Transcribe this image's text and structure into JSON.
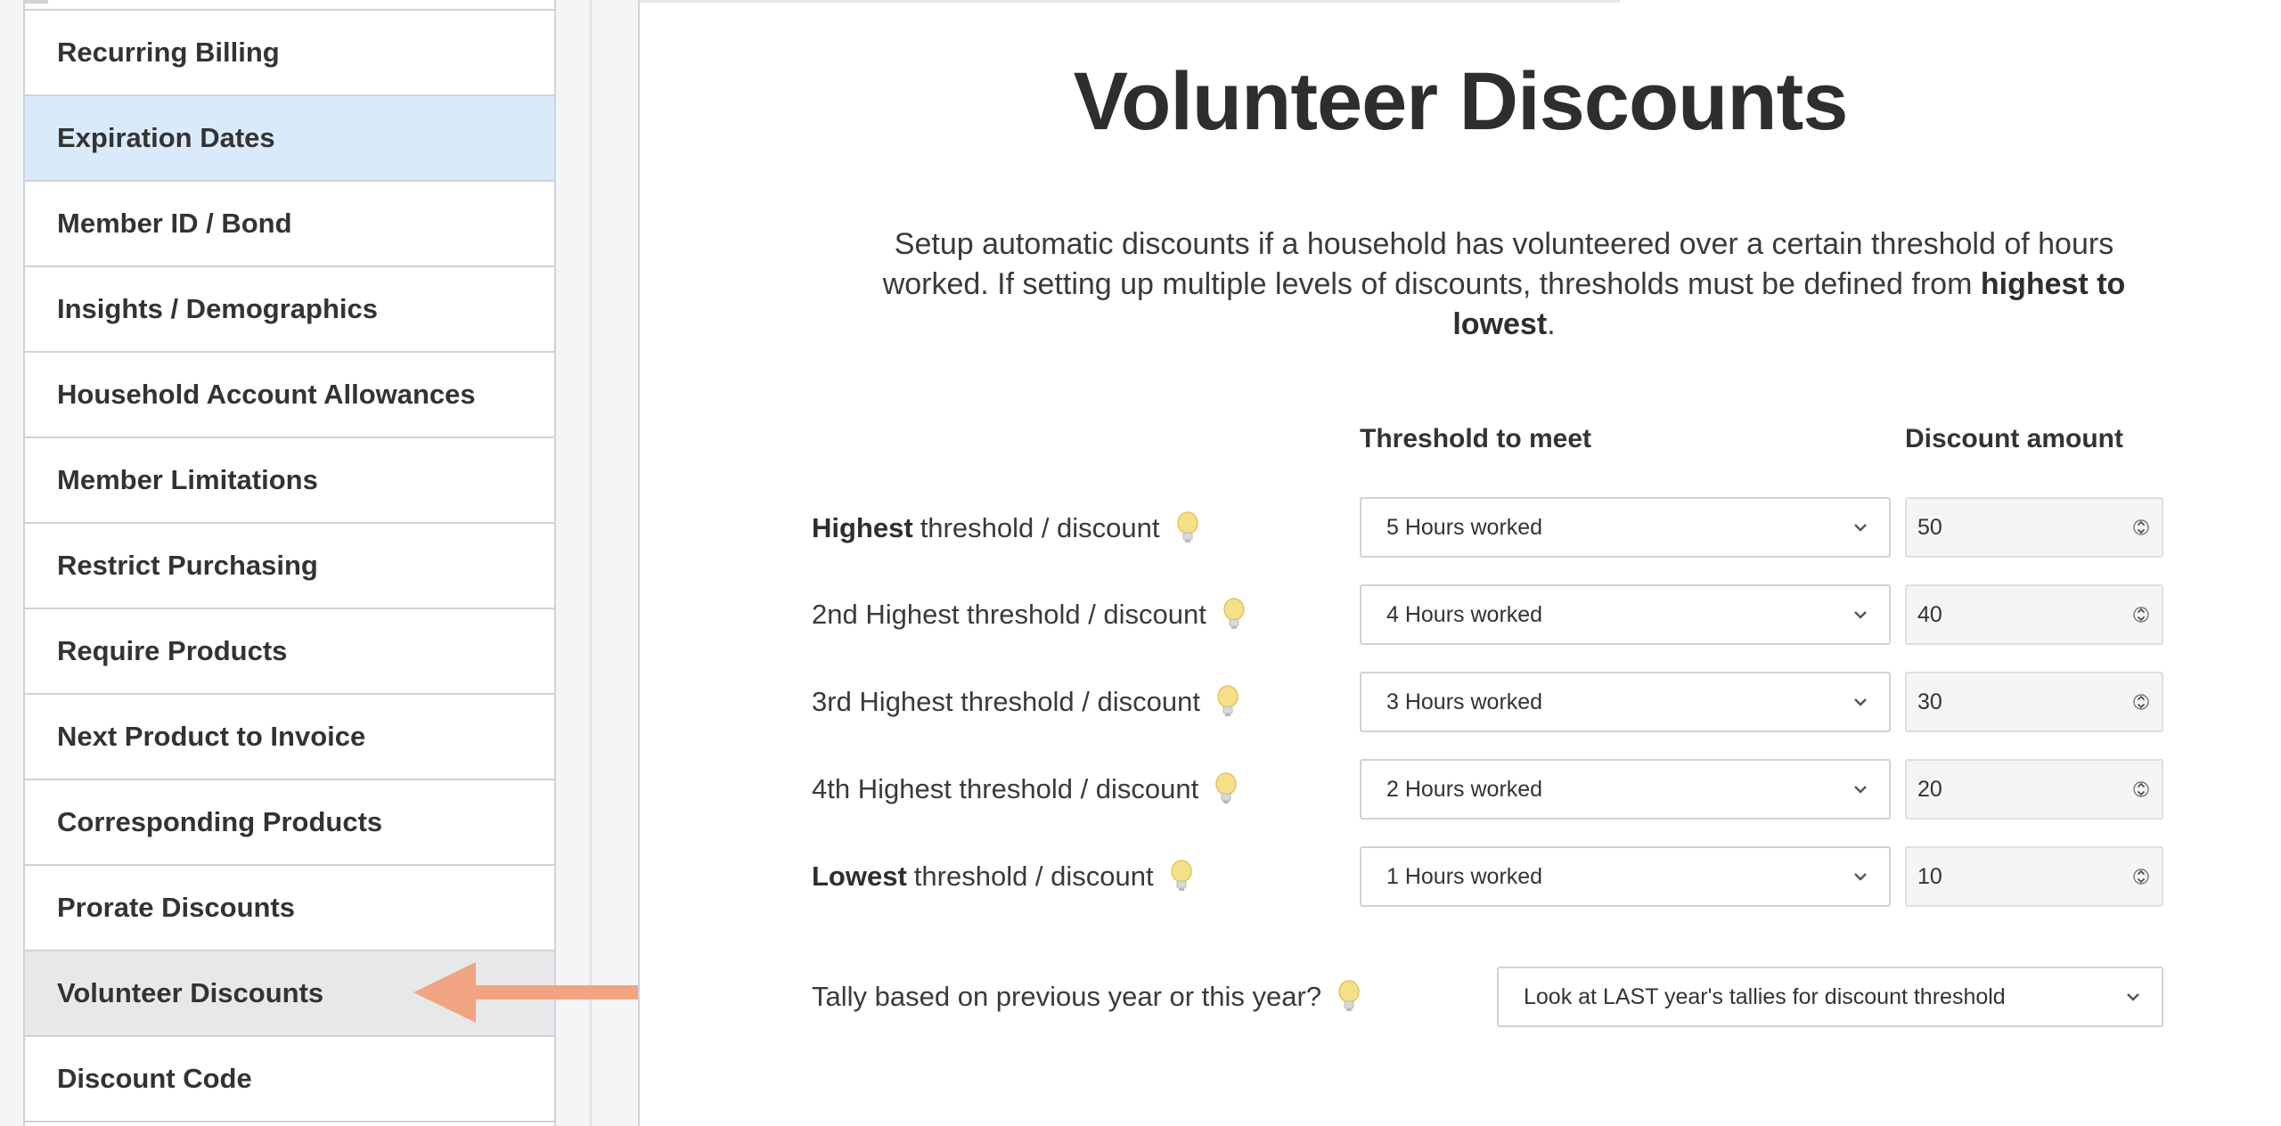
{
  "sidebar": {
    "items": [
      {
        "label": "Recurring Billing"
      },
      {
        "label": "Expiration Dates"
      },
      {
        "label": "Member ID / Bond"
      },
      {
        "label": "Insights / Demographics"
      },
      {
        "label": "Household Account Allowances"
      },
      {
        "label": "Member Limitations"
      },
      {
        "label": "Restrict Purchasing"
      },
      {
        "label": "Require Products"
      },
      {
        "label": "Next Product to Invoice"
      },
      {
        "label": "Corresponding Products"
      },
      {
        "label": "Prorate Discounts"
      },
      {
        "label": "Volunteer Discounts"
      },
      {
        "label": "Discount Code"
      }
    ],
    "highlighted_item": "Expiration Dates",
    "active_item": "Volunteer Discounts"
  },
  "main": {
    "title": "Volunteer Discounts",
    "intro": {
      "text": "Setup automatic discounts if a household has volunteered over a certain threshold of hours worked. If setting up multiple levels of discounts, thresholds must be defined from ",
      "emphasis": "highest to lowest",
      "end": "."
    },
    "columns": {
      "threshold": "Threshold to meet",
      "discount": "Discount amount"
    },
    "rows": [
      {
        "label_bold": "Highest",
        "label_rest": "threshold / discount",
        "threshold": "5 Hours worked",
        "discount": "50"
      },
      {
        "label_bold": "",
        "label_rest": "2nd Highest threshold / discount",
        "threshold": "4 Hours worked",
        "discount": "40"
      },
      {
        "label_bold": "",
        "label_rest": "3rd Highest threshold / discount",
        "threshold": "3 Hours worked",
        "discount": "30"
      },
      {
        "label_bold": "",
        "label_rest": "4th Highest threshold / discount",
        "threshold": "2 Hours worked",
        "discount": "20"
      },
      {
        "label_bold": "Lowest",
        "label_rest": "threshold / discount",
        "threshold": "1 Hours worked",
        "discount": "10"
      }
    ],
    "tally": {
      "label": "Tally based on previous year or this year?",
      "value": "Look at LAST year's tallies for discount threshold"
    }
  },
  "icons": {
    "hint": "lightbulb-icon",
    "dropdown": "chevron-down-icon",
    "number_spinner": "spinner-icon",
    "pointer": "arrow-left-icon"
  },
  "colors": {
    "highlight_item_bg": "#d9ebfb",
    "active_item_bg": "#e7e8ea",
    "arrow": "#f0a482",
    "bulb": "#f5e08a"
  }
}
